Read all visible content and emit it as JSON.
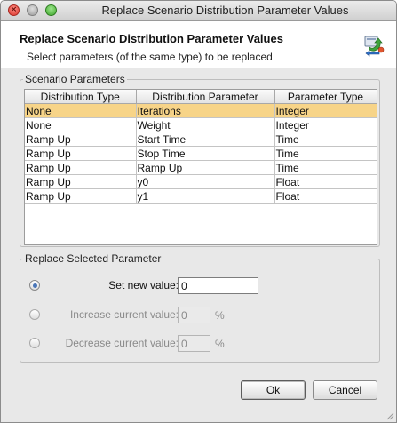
{
  "window": {
    "title": "Replace Scenario Distribution Parameter Values"
  },
  "header": {
    "title": "Replace Scenario Distribution Parameter Values",
    "message": "Select parameters (of the same type) to be replaced",
    "icon": "replace-arrows-icon"
  },
  "scenario_parameters": {
    "group_label": "Scenario Parameters",
    "columns": [
      "Distribution Type",
      "Distribution Parameter",
      "Parameter Type"
    ],
    "rows": [
      {
        "distribution_type": "None",
        "distribution_parameter": "Iterations",
        "parameter_type": "Integer",
        "selected": true
      },
      {
        "distribution_type": "None",
        "distribution_parameter": "Weight",
        "parameter_type": "Integer",
        "selected": false
      },
      {
        "distribution_type": "Ramp Up",
        "distribution_parameter": "Start Time",
        "parameter_type": "Time",
        "selected": false
      },
      {
        "distribution_type": "Ramp Up",
        "distribution_parameter": "Stop Time",
        "parameter_type": "Time",
        "selected": false
      },
      {
        "distribution_type": "Ramp Up",
        "distribution_parameter": "Ramp Up",
        "parameter_type": "Time",
        "selected": false
      },
      {
        "distribution_type": "Ramp Up",
        "distribution_parameter": "y0",
        "parameter_type": "Float",
        "selected": false
      },
      {
        "distribution_type": "Ramp Up",
        "distribution_parameter": "y1",
        "parameter_type": "Float",
        "selected": false
      }
    ]
  },
  "replace_parameter": {
    "group_label": "Replace Selected Parameter",
    "set_new_value": {
      "label": "Set new value:",
      "value": "0",
      "checked": true,
      "enabled": true
    },
    "increase_current_value": {
      "label": "Increase current value:",
      "value": "0",
      "unit": "%",
      "checked": false,
      "enabled": false
    },
    "decrease_current_value": {
      "label": "Decrease current value:",
      "value": "0",
      "unit": "%",
      "checked": false,
      "enabled": false
    }
  },
  "buttons": {
    "ok": "Ok",
    "cancel": "Cancel"
  },
  "colors": {
    "selection": "#f7d488",
    "radio_accent": "#4a76b8"
  }
}
